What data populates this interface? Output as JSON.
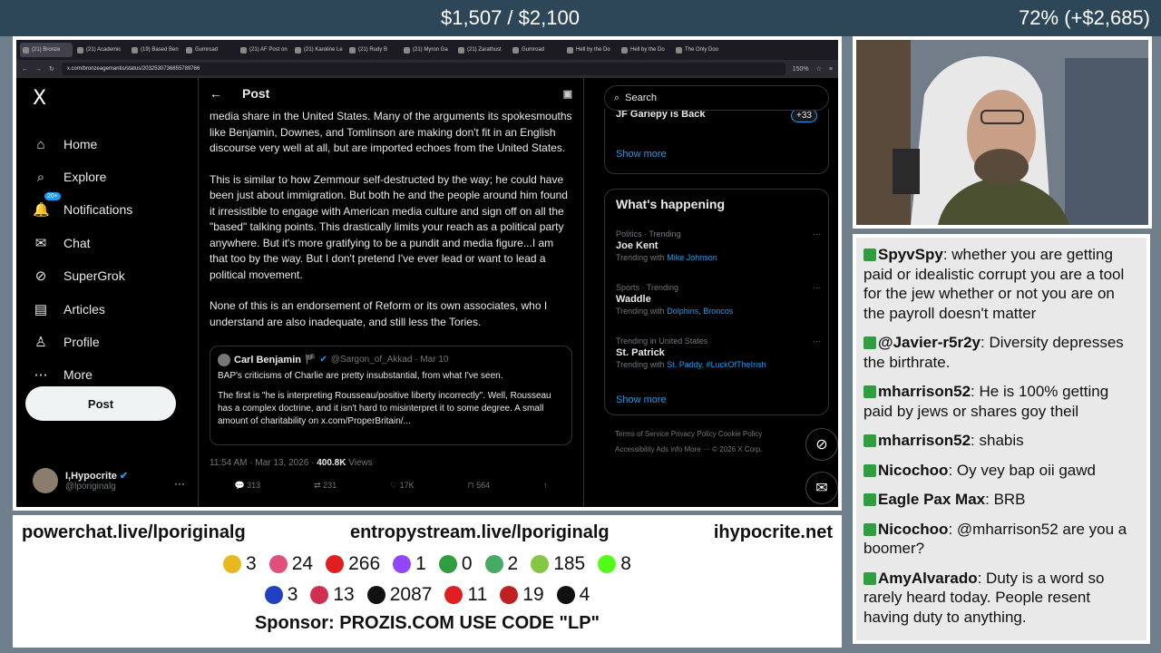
{
  "stream": {
    "goal_text": "$1,507 / $2,100",
    "goal_pct": "72% (+$2,685)"
  },
  "browser": {
    "tabs": [
      {
        "label": "(21) Bronze"
      },
      {
        "label": "(21) Academic"
      },
      {
        "label": "(19) Based Ben"
      },
      {
        "label": "Gumroad"
      },
      {
        "label": "(21) AF Post on"
      },
      {
        "label": "(21) Karoline Le"
      },
      {
        "label": "(21) Rudy B"
      },
      {
        "label": "(21) Myron Ga"
      },
      {
        "label": "(21) Zarathust"
      },
      {
        "label": "Gumroad"
      },
      {
        "label": "Hell by the Do"
      },
      {
        "label": "Hell by the Do"
      },
      {
        "label": "The Only Doo"
      }
    ],
    "url": "x.com/bronzeagemantis/status/2032530736855789766",
    "zoom": "150%"
  },
  "sidebar": {
    "logo": "X",
    "items": [
      {
        "label": "Home",
        "icon": "⌂"
      },
      {
        "label": "Explore",
        "icon": "⌕"
      },
      {
        "label": "Notifications",
        "icon": "🔔"
      },
      {
        "label": "Chat",
        "icon": "✉"
      },
      {
        "label": "SuperGrok",
        "icon": "⊘"
      },
      {
        "label": "Articles",
        "icon": "▤"
      },
      {
        "label": "Profile",
        "icon": "♙"
      },
      {
        "label": "More",
        "icon": "⋯"
      }
    ],
    "notif_badge": "20+",
    "post_label": "Post",
    "account_name": "I,Hypocrite",
    "account_handle": "@lporiginalg"
  },
  "post": {
    "header": "Post",
    "paragraphs": [
      "media share in the United States. Many of the arguments its spokesmouths like Benjamin, Downes, and Tomlinson are making don't fit in an English discourse very well at all, but are imported echoes from the United States.",
      "This is similar to how Zemmour self-destructed by the way; he could have been just about immigration. But both he and the people around him found it irresistible to engage with American media culture and sign off on all the \"based\" talking points. This drastically limits your reach as a political party anywhere. But it's more gratifying to be a pundit and media figure...I am that too by the way. But I don't pretend I've ever lead or want to lead a political movement.",
      "None of this is an endorsement of Reform or its own associates, who I understand are also inadequate, and still less the Tories."
    ],
    "quote": {
      "name": "Carl Benjamin",
      "flag": "🏴",
      "handle": "@Sargon_of_Akkad · Mar 10",
      "line1": "BAP's criticisms of Charlie are pretty insubstantial, from what I've seen.",
      "line2": "The first is \"he is interpreting Rousseau/positive liberty incorrectly\". Well, Rousseau has a complex doctrine, and it isn't hard to misinterpret it to some degree. A small amount of charitability on x.com/ProperBritain/..."
    },
    "time": "11:54 AM · Mar 13, 2026 · ",
    "views": "400.8K",
    "views_label": " Views",
    "actions": [
      "313",
      "231",
      "17K",
      "564"
    ]
  },
  "right": {
    "search_placeholder": "Search",
    "card1_title": "JF Gariepy is Back",
    "card1_plus": "+33",
    "show_more": "Show more",
    "happening_title": "What's happening",
    "trends": [
      {
        "context": "Politics · Trending",
        "name": "Joe Kent",
        "with_prefix": "Trending with ",
        "with": "Mike Johnson"
      },
      {
        "context": "Sports · Trending",
        "name": "Waddle",
        "with_prefix": "Trending with ",
        "with": "Dolphins, Broncos"
      },
      {
        "context": "Trending in United States",
        "name": "St. Patrick",
        "with_prefix": "Trending with ",
        "with": "St. Paddy, #LuckOfTheIrish"
      }
    ],
    "footer": "Terms of Service   Privacy Policy   Cookie Policy   Accessibility   Ads info   More ···   © 2026 X Corp."
  },
  "chat": [
    {
      "user": "SpyvSpy",
      "text": ": whether you are getting paid or idealistic corrupt you are a tool for the jew whether or not you are on the payroll doesn't matter"
    },
    {
      "user": "@Javier-r5r2y",
      "text": ": Diversity depresses the birthrate."
    },
    {
      "user": "mharrison52",
      "text": ": He is 100% getting paid by jews or shares goy theil"
    },
    {
      "user": "mharrison52",
      "text": ": shabis"
    },
    {
      "user": "Nicochoo",
      "text": ": Oy vey bap oii gawd"
    },
    {
      "user": "Eagle Pax Max",
      "text": ": BRB"
    },
    {
      "user": "Nicochoo",
      "text": ": @mharrison52 are you a boomer?"
    },
    {
      "user": "AmyAlvarado",
      "text": ": Duty is a word so rarely heard today. People resent having duty to anything."
    }
  ],
  "panel": {
    "links": [
      "powerchat.live/lporiginalg",
      "entropystream.live/lporiginalg",
      "ihypocrite.net"
    ],
    "counts_row1": [
      {
        "icon": "smiley-icon",
        "color": "#e8b820",
        "value": "3"
      },
      {
        "icon": "pinwheel-icon",
        "color": "#e0507a",
        "value": "24"
      },
      {
        "icon": "youtube-icon",
        "color": "#e02020",
        "value": "266"
      },
      {
        "icon": "twitch-icon",
        "color": "#9146ff",
        "value": "1"
      },
      {
        "icon": "rumble-leaf-icon",
        "color": "#2e9e3e",
        "value": "0"
      },
      {
        "icon": "orb-icon",
        "color": "#44aa66",
        "value": "2"
      },
      {
        "icon": "rumble-icon",
        "color": "#85c742",
        "value": "185"
      },
      {
        "icon": "kick-icon",
        "color": "#53fc18",
        "value": "8"
      }
    ],
    "counts_row2": [
      {
        "icon": "moon-icon",
        "color": "#2040c0",
        "value": "3"
      },
      {
        "icon": "pill-icon",
        "color": "#d03050",
        "value": "13"
      },
      {
        "icon": "x-icon",
        "color": "#111111",
        "value": "2087"
      },
      {
        "icon": "c-icon",
        "color": "#e02020",
        "value": "11"
      },
      {
        "icon": "cross-icon",
        "color": "#c02020",
        "value": "19"
      },
      {
        "icon": "grid-icon",
        "color": "#111111",
        "value": "4"
      }
    ],
    "sponsor": "Sponsor: PROZIS.COM USE CODE \"LP\""
  }
}
